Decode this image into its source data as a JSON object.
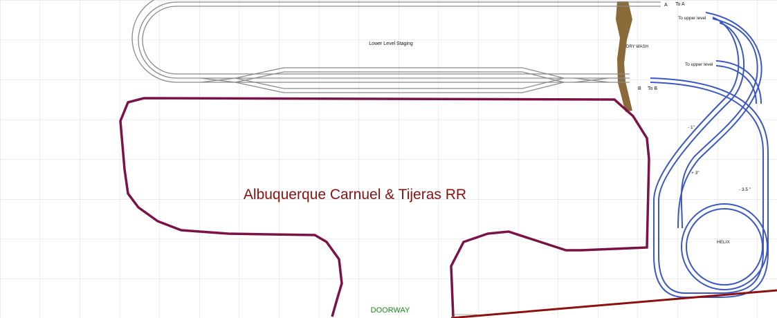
{
  "title": "Albuquerque Carnuel & Tijeras RR",
  "labels": {
    "staging": "Lower Level Staging",
    "dry_wash": "DRY WASH",
    "to_a": "To A",
    "to_b": "To B",
    "a_marker": "A",
    "b_marker": "B",
    "to_upper_1": "To upper level",
    "to_upper_2": "To upper level",
    "grade_minus_1": "- 1\"",
    "grade_plus_3": "+ 3\"",
    "grade_minus_35": "- 3.5 \"",
    "helix": "HELIX",
    "doorway": "DOORWAY"
  },
  "colors": {
    "grid": "#d9d9d9",
    "track_grey": "#8a8a8a",
    "track_blue": "#3a57c4",
    "benchwork": "#7a1248",
    "wall": "#8b1010",
    "dry_wash": "#8b6a3a",
    "title": "#8b1010",
    "doorway": "#1a8a1a"
  }
}
